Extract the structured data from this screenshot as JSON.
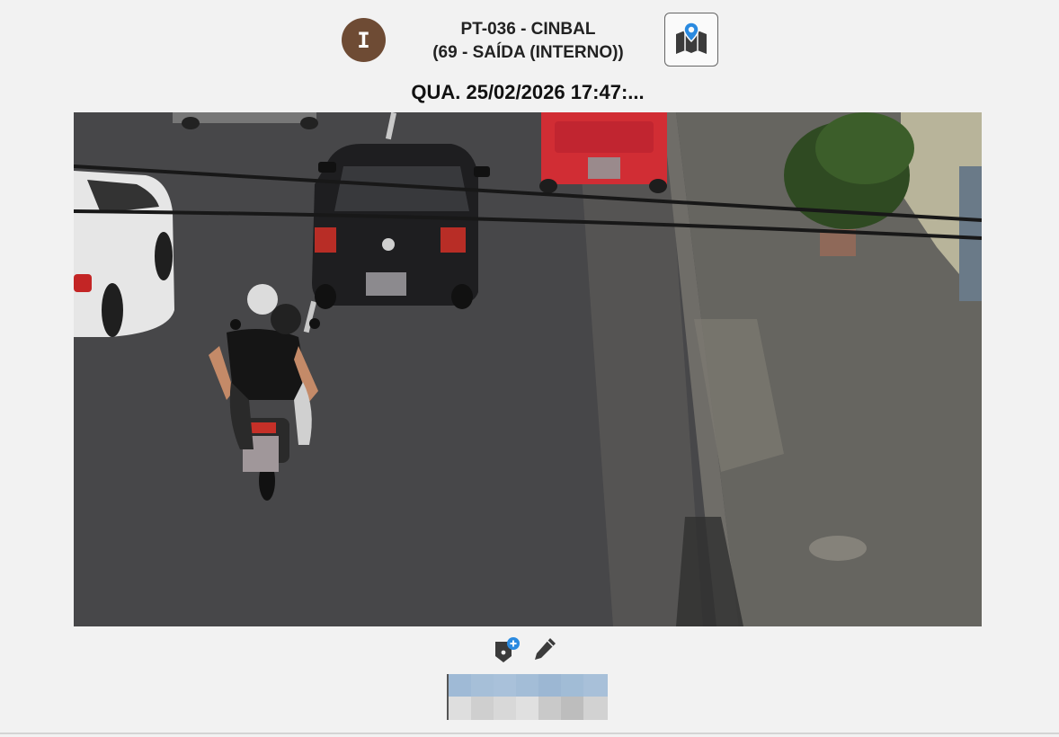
{
  "header": {
    "badge_letter": "I",
    "title_line1": "PT-036 - CINBAL",
    "title_line2": "(69 - SAÍDA (INTERNO))",
    "map_icon": "map-pin-icon"
  },
  "capture": {
    "datetime": "QUA. 25/02/2026 17:47:..."
  },
  "actions": {
    "tag_icon": "add-tag-icon",
    "edit_icon": "pen-icon"
  },
  "colors": {
    "badge": "#6e4b34",
    "map_pin": "#2a8ae0",
    "background": "#f2f2f2"
  }
}
